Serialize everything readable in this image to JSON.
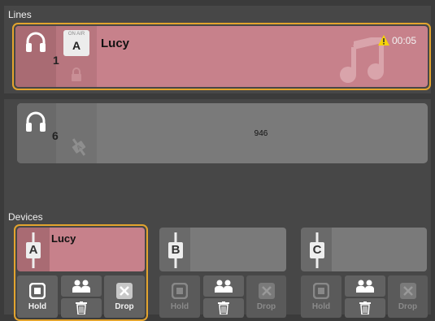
{
  "lines_section": {
    "title": "Lines"
  },
  "line1": {
    "number": "1",
    "on_air_badge": "ON AIR",
    "on_air_letter": "A",
    "caller_name": "Lucy",
    "timer": "00:05",
    "icons": [
      "headset-icon",
      "lock-icon",
      "music-note-icon",
      "warning-icon"
    ]
  },
  "line6": {
    "number": "6",
    "caller_number": "946",
    "icons": [
      "headset-icon",
      "fader-icon"
    ]
  },
  "devices_section": {
    "title": "Devices"
  },
  "devices": [
    {
      "letter": "A",
      "name": "Lucy",
      "active": true
    },
    {
      "letter": "B",
      "name": "",
      "active": false
    },
    {
      "letter": "C",
      "name": "",
      "active": false
    }
  ],
  "buttons": {
    "hold": "Hold",
    "drop": "Drop"
  },
  "colors": {
    "accent_border": "#e3a42e",
    "on_air_pink": "#c7818b",
    "idle_grey": "#7a7a7a",
    "warning": "#f5d20a"
  }
}
